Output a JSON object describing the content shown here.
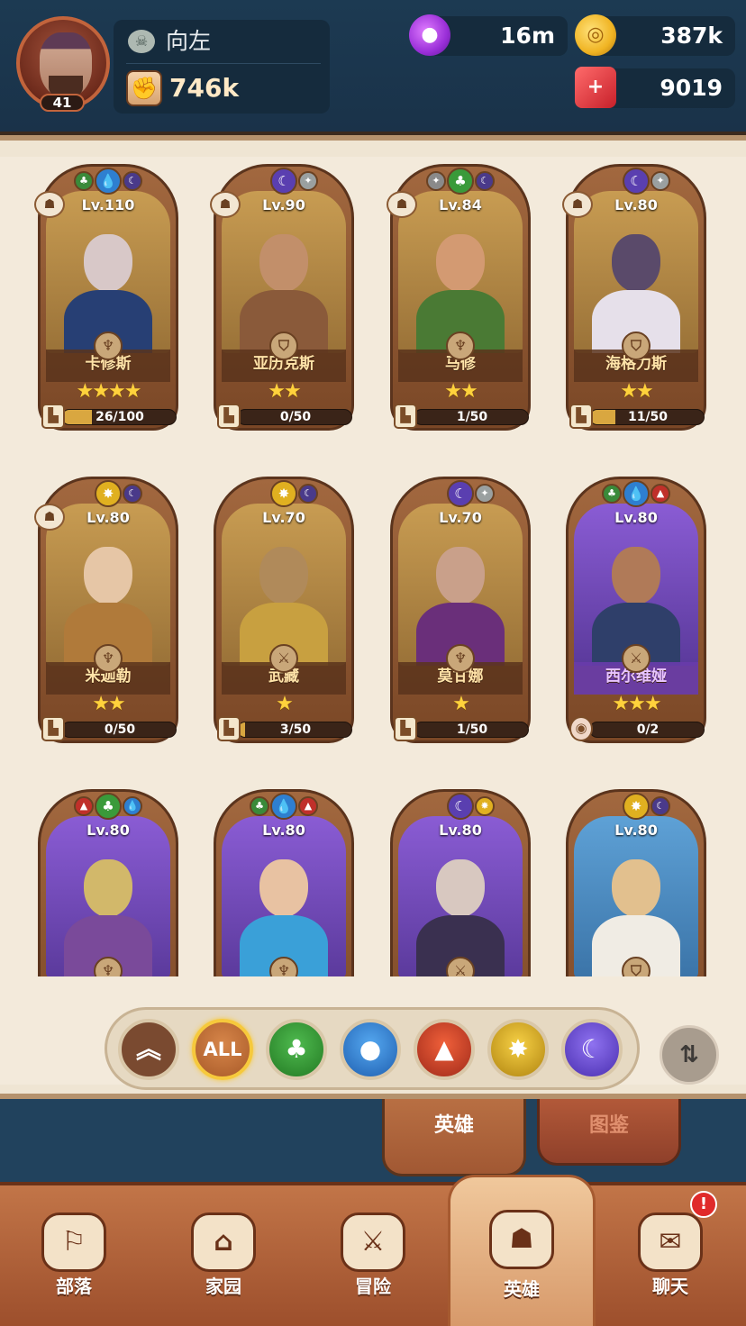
{
  "player": {
    "name": "向左",
    "level": "41",
    "power": "746k"
  },
  "resources": {
    "potion": "16m",
    "gold": "387k",
    "gems": "9019"
  },
  "heroes": [
    {
      "level": "Lv.110",
      "name": "卡修斯",
      "stars": "★★★★",
      "progress": "26/100",
      "fill": 0.26
    },
    {
      "level": "Lv.90",
      "name": "亚历克斯",
      "stars": "★★",
      "progress": "0/50",
      "fill": 0
    },
    {
      "level": "Lv.84",
      "name": "马修",
      "stars": "★★",
      "progress": "1/50",
      "fill": 0.02
    },
    {
      "level": "Lv.80",
      "name": "海格力斯",
      "stars": "★★",
      "progress": "11/50",
      "fill": 0.22
    },
    {
      "level": "Lv.80",
      "name": "米迦勒",
      "stars": "★★",
      "progress": "0/50",
      "fill": 0
    },
    {
      "level": "Lv.70",
      "name": "武藏",
      "stars": "★",
      "progress": "3/50",
      "fill": 0.06
    },
    {
      "level": "Lv.70",
      "name": "莫甘娜",
      "stars": "★",
      "progress": "1/50",
      "fill": 0.02
    },
    {
      "level": "Lv.80",
      "name": "西尔维娅",
      "stars": "★★★",
      "progress": "0/2",
      "fill": 0
    },
    {
      "level": "Lv.80"
    },
    {
      "level": "Lv.80"
    },
    {
      "level": "Lv.80"
    },
    {
      "level": "Lv.80"
    }
  ],
  "filters": {
    "all_label": "ALL"
  },
  "tabs": {
    "heroes": "英雄",
    "book": "图鉴"
  },
  "nav": {
    "tribe": "部落",
    "home": "家园",
    "adventure": "冒险",
    "heroes": "英雄",
    "chat": "聊天",
    "chat_alert": "!"
  }
}
